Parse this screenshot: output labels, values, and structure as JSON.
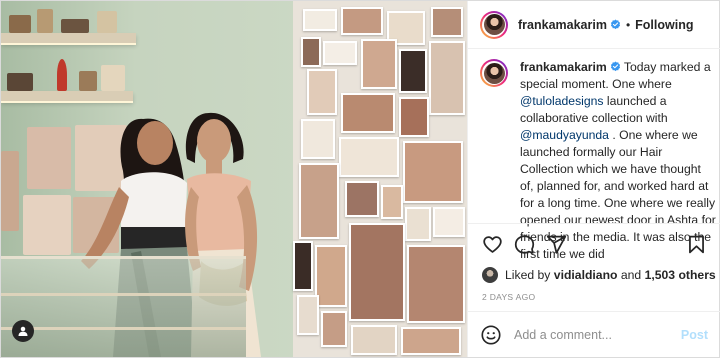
{
  "post": {
    "username": "frankamakarim",
    "follow_status": "Following",
    "separator": "•"
  },
  "caption": {
    "username": "frankamakarim",
    "part1": " Today marked a special moment. One where ",
    "mention1": "@tuloladesigns",
    "part2": " launched a collaborative collection with ",
    "mention2": "@maudyayunda",
    "part3": " . One where we launched formally our Hair Collection which we have thought of, planned for, and worked hard at for a long time. One where we really opened our newest door in Ashta for friends in the media. It was also the first time we did"
  },
  "likes": {
    "prefix": "Liked by ",
    "user": "vidialdiano",
    "middle": " and ",
    "count": "1,503 others"
  },
  "date": "2 DAYS AGO",
  "comment": {
    "placeholder": "Add a comment...",
    "post_label": "Post"
  },
  "icons": {
    "verified": "verified-badge-icon",
    "like": "heart-icon",
    "comment": "speech-bubble-icon",
    "share": "paper-plane-icon",
    "save": "bookmark-icon",
    "emoji": "smiley-icon",
    "tag": "user-tag-icon"
  },
  "colors": {
    "verified": "#3897f0",
    "link": "#00376b",
    "muted": "#8e8e8e",
    "post_button": "#b2dffc"
  }
}
